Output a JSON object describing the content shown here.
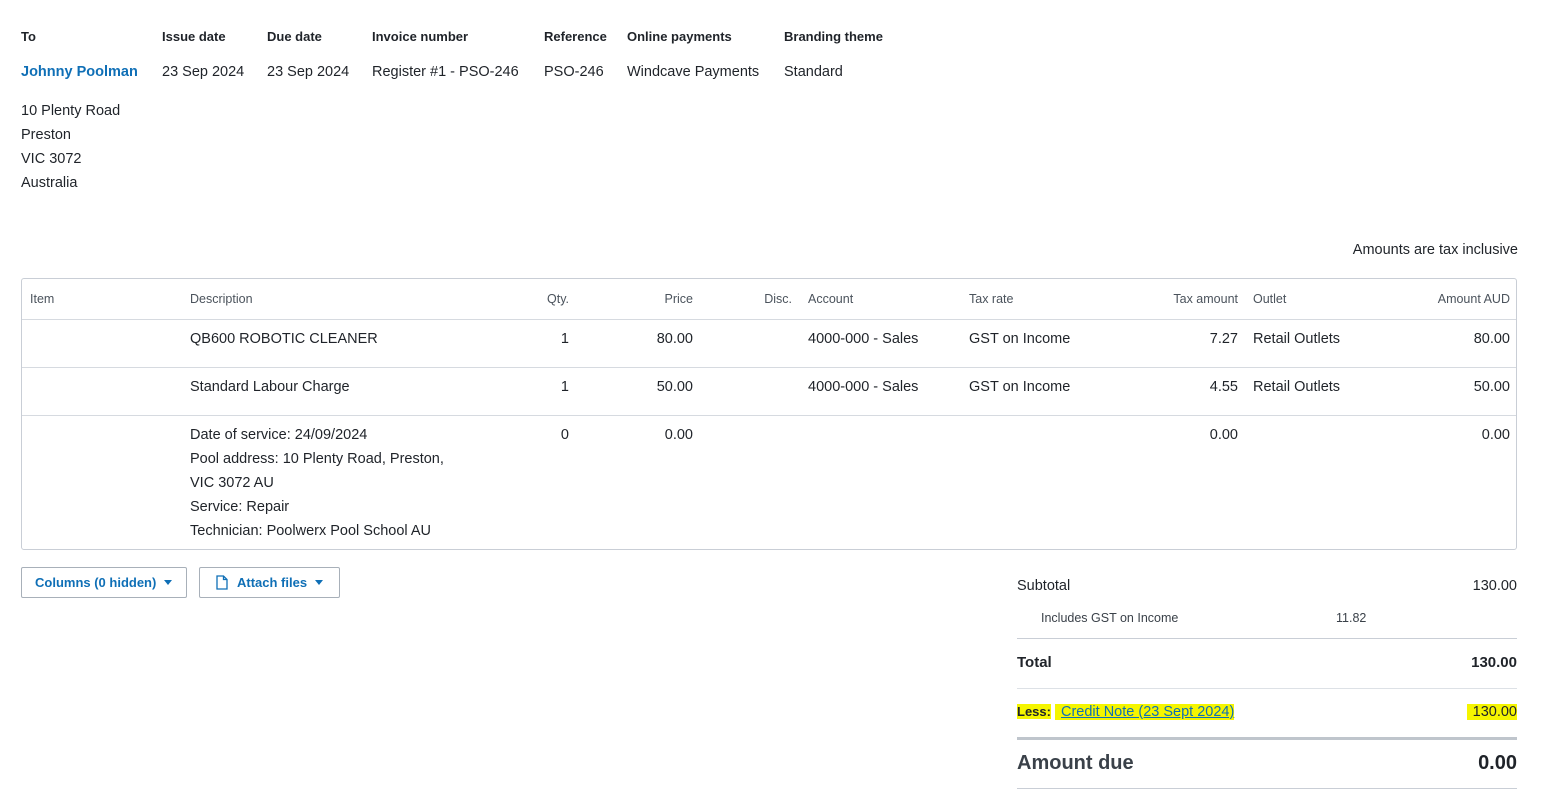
{
  "header": {
    "columns": [
      {
        "label": "To",
        "value": "Johnny Poolman"
      },
      {
        "label": "Issue date",
        "value": "23 Sep 2024"
      },
      {
        "label": "Due date",
        "value": "23 Sep 2024"
      },
      {
        "label": "Invoice number",
        "value": "Register #1 - PSO-246"
      },
      {
        "label": "Reference",
        "value": "PSO-246"
      },
      {
        "label": "Online payments",
        "value": "Windcave Payments"
      },
      {
        "label": "Branding theme",
        "value": "Standard"
      }
    ],
    "address": [
      "10 Plenty Road",
      "Preston",
      "VIC 3072",
      "Australia"
    ]
  },
  "tax_note": "Amounts are tax inclusive",
  "table": {
    "headers": {
      "item": "Item",
      "description": "Description",
      "qty": "Qty.",
      "price": "Price",
      "disc": "Disc.",
      "account": "Account",
      "tax_rate": "Tax rate",
      "tax_amount": "Tax amount",
      "outlet": "Outlet",
      "amount": "Amount AUD"
    },
    "rows": [
      {
        "item": "",
        "description": "QB600 ROBOTIC CLEANER",
        "qty": "1",
        "price": "80.00",
        "disc": "",
        "account": "4000-000 - Sales",
        "tax_rate": "GST on Income",
        "tax_amount": "7.27",
        "outlet": "Retail Outlets",
        "amount": "80.00"
      },
      {
        "item": "",
        "description": "Standard Labour Charge",
        "qty": "1",
        "price": "50.00",
        "disc": "",
        "account": "4000-000 - Sales",
        "tax_rate": "GST on Income",
        "tax_amount": "4.55",
        "outlet": "Retail Outlets",
        "amount": "50.00"
      },
      {
        "item": "",
        "description_lines": [
          "Date of service: 24/09/2024",
          "Pool address: 10 Plenty Road, Preston,",
          "VIC 3072 AU",
          "Service: Repair",
          "Technician: Poolwerx Pool School AU"
        ],
        "qty": "0",
        "price": "0.00",
        "disc": "",
        "account": "",
        "tax_rate": "",
        "tax_amount": "0.00",
        "outlet": "",
        "amount": "0.00"
      }
    ]
  },
  "buttons": {
    "columns": "Columns (0 hidden)",
    "attach": "Attach files"
  },
  "summary": {
    "subtotal_label": "Subtotal",
    "subtotal": "130.00",
    "gst_label": "Includes GST on Income",
    "gst": "11.82",
    "total_label": "Total",
    "total": "130.00",
    "less_label": "Less:",
    "credit_note": "Credit Note (23 Sept 2024)",
    "less_amount": "130.00",
    "amount_due_label": "Amount due",
    "amount_due": "0.00"
  },
  "colors": {
    "link": "#0f6fb6",
    "highlight": "#f5f500"
  },
  "icons": {
    "attach": "document-icon",
    "dropdown": "caret-down-icon"
  }
}
